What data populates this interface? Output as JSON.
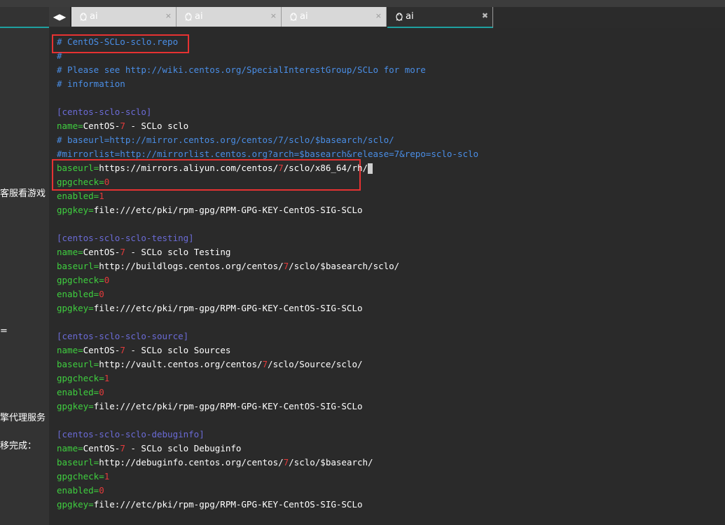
{
  "tabs": [
    {
      "label": "ai",
      "close": "×"
    },
    {
      "label": "ai",
      "close": "×"
    },
    {
      "label": "ai",
      "close": "×"
    },
    {
      "label": "ai",
      "close": "✖"
    }
  ],
  "nav": {
    "arrows": "◀▶"
  },
  "left_panel": {
    "frag1": "客服看游戏",
    "frag2": "=",
    "frag3": "擎代理服务",
    "frag4": "移完成："
  },
  "terminal": {
    "lines": [
      {
        "seg": [
          [
            "c-comment",
            "# CentOS-SCLo-sclo.repo"
          ]
        ]
      },
      {
        "seg": [
          [
            "c-comment",
            "#"
          ]
        ]
      },
      {
        "seg": [
          [
            "c-comment",
            "# Please see http://wiki.centos.org/SpecialInterestGroup/SCLo for more"
          ]
        ]
      },
      {
        "seg": [
          [
            "c-comment",
            "# information"
          ]
        ]
      },
      {
        "seg": []
      },
      {
        "seg": [
          [
            "c-section",
            "[centos-sclo-sclo]"
          ]
        ]
      },
      {
        "seg": [
          [
            "c-key",
            "name="
          ],
          [
            "c-val",
            "CentOS-"
          ],
          [
            "c-num",
            "7"
          ],
          [
            "c-val",
            " - SCLo sclo"
          ]
        ]
      },
      {
        "seg": [
          [
            "c-comment",
            "# baseurl=http://mirror.centos.org/centos/7/sclo/$basearch/sclo/"
          ]
        ]
      },
      {
        "seg": [
          [
            "c-comment",
            "#mirrorlist=http://mirrorlist.centos.org?arch=$basearch&release=7&repo=sclo-sclo"
          ]
        ]
      },
      {
        "seg": [
          [
            "c-key",
            "baseurl="
          ],
          [
            "c-val",
            "https://mirrors.aliyun.com/centos/"
          ],
          [
            "c-num",
            "7"
          ],
          [
            "c-val",
            "/sclo/x86_64/rh/"
          ]
        ],
        "cursor": true
      },
      {
        "seg": [
          [
            "c-key",
            "gpgcheck="
          ],
          [
            "c-num",
            "0"
          ]
        ]
      },
      {
        "seg": [
          [
            "c-key",
            "enabled="
          ],
          [
            "c-num",
            "1"
          ]
        ]
      },
      {
        "seg": [
          [
            "c-key",
            "gpgkey="
          ],
          [
            "c-val",
            "file:///etc/pki/rpm-gpg/RPM-GPG-KEY-CentOS-SIG-SCLo"
          ]
        ]
      },
      {
        "seg": []
      },
      {
        "seg": [
          [
            "c-section",
            "[centos-sclo-sclo-testing]"
          ]
        ]
      },
      {
        "seg": [
          [
            "c-key",
            "name="
          ],
          [
            "c-val",
            "CentOS-"
          ],
          [
            "c-num",
            "7"
          ],
          [
            "c-val",
            " - SCLo sclo Testing"
          ]
        ]
      },
      {
        "seg": [
          [
            "c-key",
            "baseurl="
          ],
          [
            "c-val",
            "http://buildlogs.centos.org/centos/"
          ],
          [
            "c-num",
            "7"
          ],
          [
            "c-val",
            "/sclo/$basearch/sclo/"
          ]
        ]
      },
      {
        "seg": [
          [
            "c-key",
            "gpgcheck="
          ],
          [
            "c-num",
            "0"
          ]
        ]
      },
      {
        "seg": [
          [
            "c-key",
            "enabled="
          ],
          [
            "c-num",
            "0"
          ]
        ]
      },
      {
        "seg": [
          [
            "c-key",
            "gpgkey="
          ],
          [
            "c-val",
            "file:///etc/pki/rpm-gpg/RPM-GPG-KEY-CentOS-SIG-SCLo"
          ]
        ]
      },
      {
        "seg": []
      },
      {
        "seg": [
          [
            "c-section",
            "[centos-sclo-sclo-source]"
          ]
        ]
      },
      {
        "seg": [
          [
            "c-key",
            "name="
          ],
          [
            "c-val",
            "CentOS-"
          ],
          [
            "c-num",
            "7"
          ],
          [
            "c-val",
            " - SCLo sclo Sources"
          ]
        ]
      },
      {
        "seg": [
          [
            "c-key",
            "baseurl="
          ],
          [
            "c-val",
            "http://vault.centos.org/centos/"
          ],
          [
            "c-num",
            "7"
          ],
          [
            "c-val",
            "/sclo/Source/sclo/"
          ]
        ]
      },
      {
        "seg": [
          [
            "c-key",
            "gpgcheck="
          ],
          [
            "c-num",
            "1"
          ]
        ]
      },
      {
        "seg": [
          [
            "c-key",
            "enabled="
          ],
          [
            "c-num",
            "0"
          ]
        ]
      },
      {
        "seg": [
          [
            "c-key",
            "gpgkey="
          ],
          [
            "c-val",
            "file:///etc/pki/rpm-gpg/RPM-GPG-KEY-CentOS-SIG-SCLo"
          ]
        ]
      },
      {
        "seg": []
      },
      {
        "seg": [
          [
            "c-section",
            "[centos-sclo-sclo-debuginfo]"
          ]
        ]
      },
      {
        "seg": [
          [
            "c-key",
            "name="
          ],
          [
            "c-val",
            "CentOS-"
          ],
          [
            "c-num",
            "7"
          ],
          [
            "c-val",
            " - SCLo sclo Debuginfo"
          ]
        ]
      },
      {
        "seg": [
          [
            "c-key",
            "baseurl="
          ],
          [
            "c-val",
            "http://debuginfo.centos.org/centos/"
          ],
          [
            "c-num",
            "7"
          ],
          [
            "c-val",
            "/sclo/$basearch/"
          ]
        ]
      },
      {
        "seg": [
          [
            "c-key",
            "gpgcheck="
          ],
          [
            "c-num",
            "1"
          ]
        ]
      },
      {
        "seg": [
          [
            "c-key",
            "enabled="
          ],
          [
            "c-num",
            "0"
          ]
        ]
      },
      {
        "seg": [
          [
            "c-key",
            "gpgkey="
          ],
          [
            "c-val",
            "file:///etc/pki/rpm-gpg/RPM-GPG-KEY-CentOS-SIG-SCLo"
          ]
        ]
      }
    ]
  },
  "colors": {
    "comment": "#4a8ee6",
    "section": "#6b6bd6",
    "key": "#3fcf3f",
    "number": "#e23b3b",
    "highlight_box": "#e63232",
    "tab_accent": "#1fa0a0"
  }
}
